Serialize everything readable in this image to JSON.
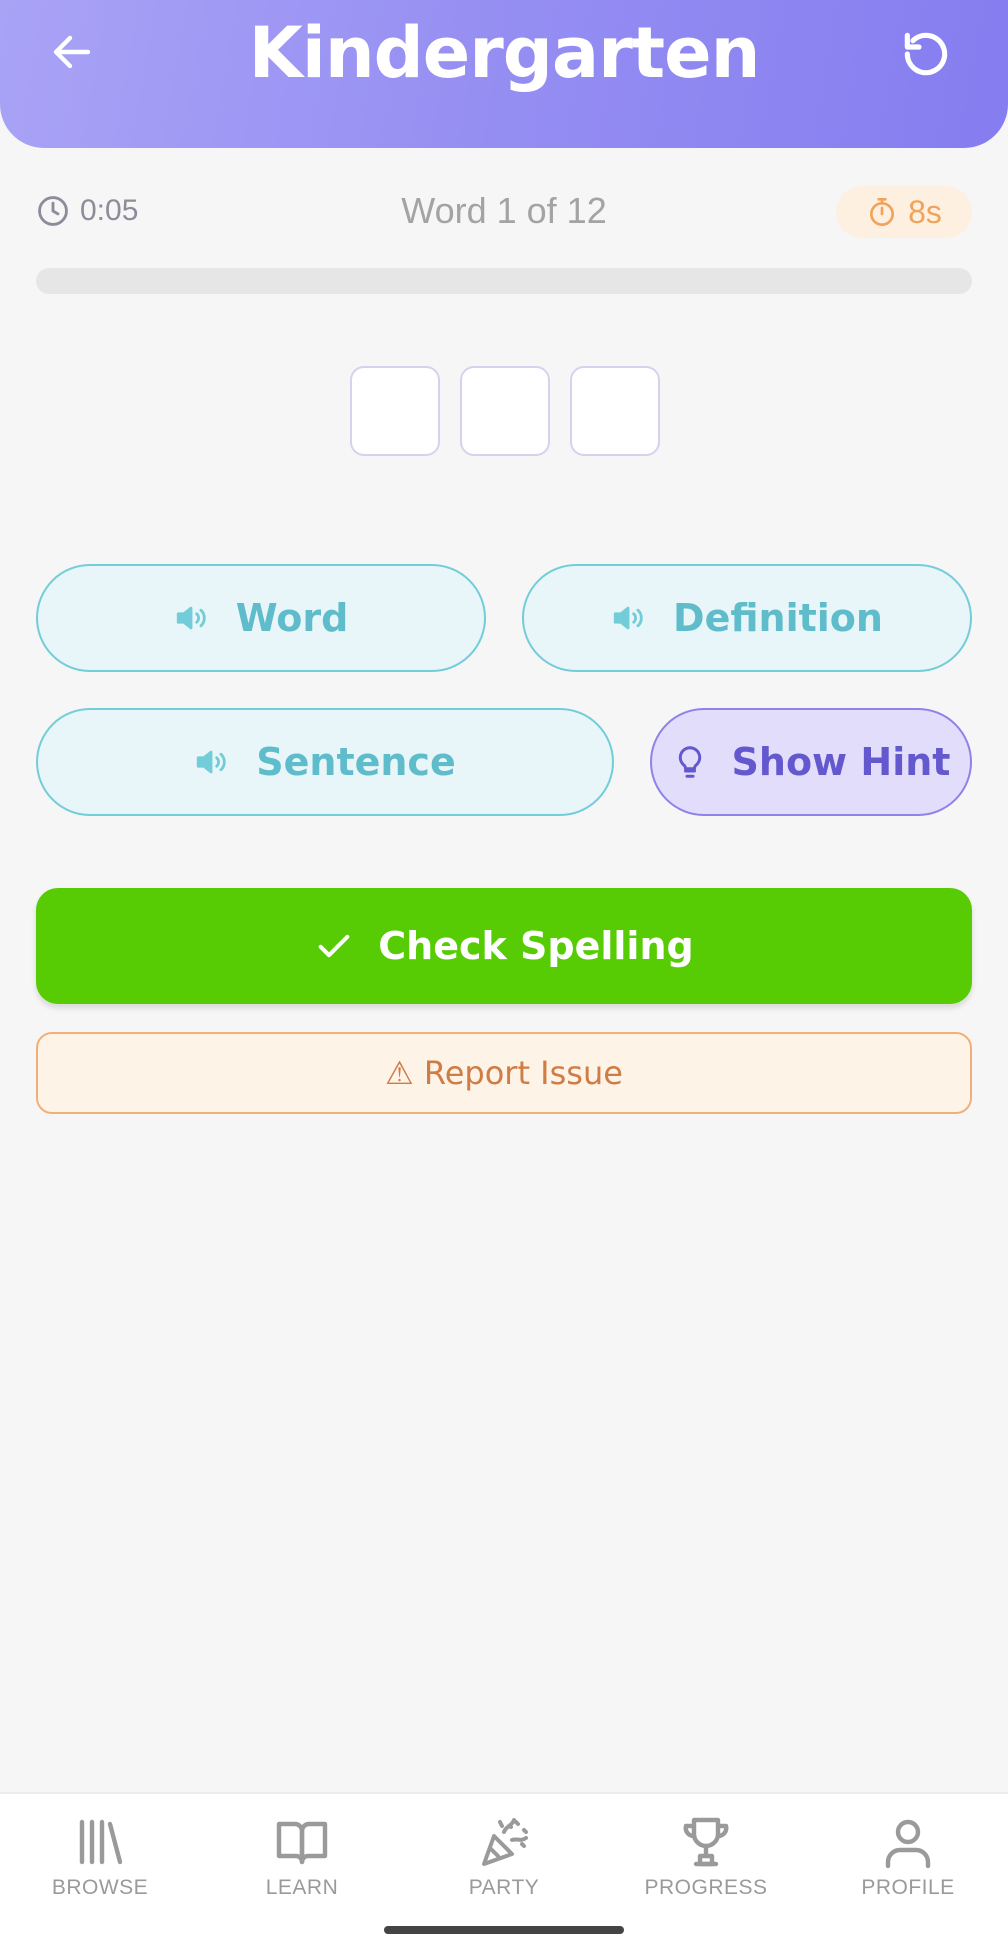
{
  "header": {
    "title": "Kindergarten"
  },
  "status": {
    "elapsed": "0:05",
    "counter": "Word 1 of 12",
    "countdown": "8s"
  },
  "progress": {
    "fraction": 0.0
  },
  "letter_boxes": {
    "count": 3
  },
  "buttons": {
    "word": "Word",
    "definition": "Definition",
    "sentence": "Sentence",
    "hint": "Show Hint",
    "check": "Check Spelling",
    "report": "⚠ Report Issue"
  },
  "nav": {
    "items": [
      {
        "label": "BROWSE",
        "icon": "library-icon"
      },
      {
        "label": "LEARN",
        "icon": "book-icon"
      },
      {
        "label": "PARTY",
        "icon": "party-popper-icon"
      },
      {
        "label": "PROGRESS",
        "icon": "trophy-icon"
      },
      {
        "label": "PROFILE",
        "icon": "user-icon"
      }
    ]
  },
  "colors": {
    "header_gradient_start": "#a9a3f6",
    "header_gradient_end": "#857df0",
    "audio_button": "#5fbccb",
    "hint_button": "#6458cf",
    "check_button": "#57cc04",
    "report_button": "#cf7c45",
    "countdown": "#f1a35a"
  }
}
